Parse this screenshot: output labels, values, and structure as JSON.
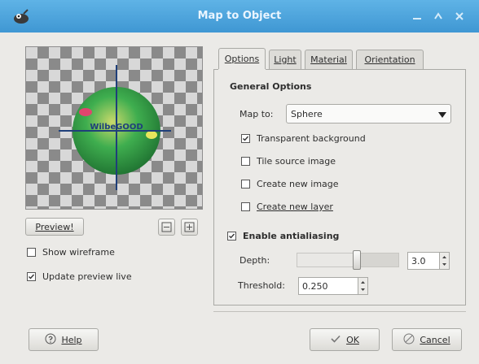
{
  "window": {
    "title": "Map to Object",
    "controls": [
      "minimize-icon",
      "maximize-icon",
      "close-icon"
    ]
  },
  "preview": {
    "button_label": "Preview!",
    "button_mnemonic": "P",
    "preview_text": "WilbeGOOD",
    "zoom_buttons": [
      "zoom-out-icon",
      "zoom-in-icon"
    ],
    "show_wireframe": {
      "label": "Show wireframe",
      "checked": false
    },
    "update_live": {
      "label": "Update preview live",
      "checked": true
    }
  },
  "tabs": [
    {
      "label": "Options",
      "active": true
    },
    {
      "label": "Light",
      "active": false
    },
    {
      "label": "Material",
      "active": false
    },
    {
      "label": "Orientation",
      "active": false
    }
  ],
  "general_options": {
    "title": "General Options",
    "map_to_label": "Map to:",
    "map_to_value": "Sphere",
    "checkboxes": [
      {
        "label": "Transparent background",
        "checked": true
      },
      {
        "label": "Tile source image",
        "checked": false
      },
      {
        "label": "Create new image",
        "checked": false
      },
      {
        "label": "Create new layer",
        "checked": false
      }
    ]
  },
  "antialiasing": {
    "title": "Enable antialiasing",
    "checked": true,
    "depth_label": "Depth:",
    "depth_value": "3.0",
    "depth_fraction": 0.6,
    "threshold_label": "Threshold:",
    "threshold_value": "0.250"
  },
  "actions": {
    "help": "Help",
    "ok": "OK",
    "cancel": "Cancel"
  },
  "colors": {
    "titlebar": "#4aa3dc",
    "sphere": "#2fa24a",
    "sphere_highlight": "#e0e05a",
    "pink_spot": "#e0456e",
    "axis": "#1f3f7a"
  }
}
